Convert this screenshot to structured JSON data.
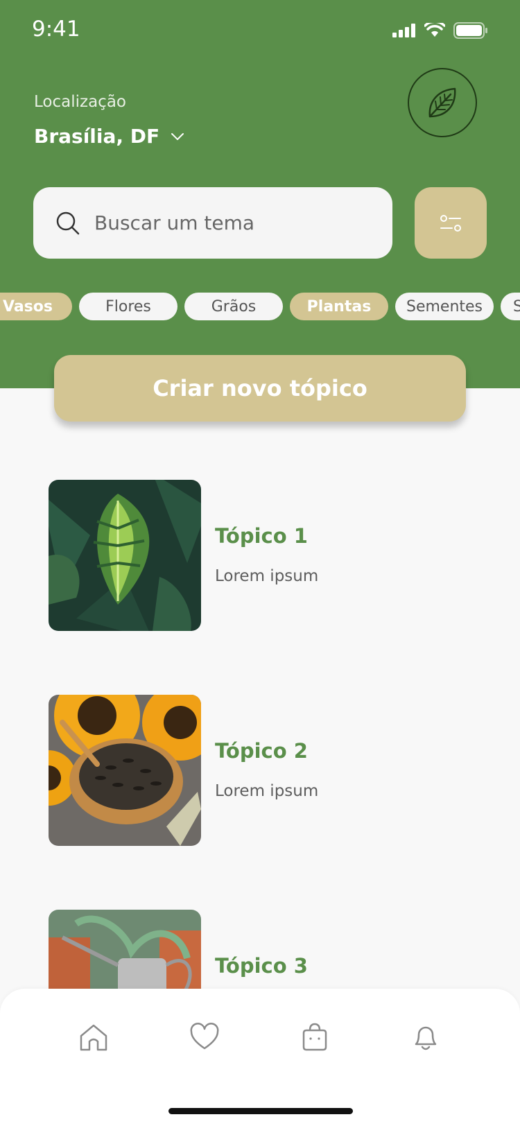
{
  "status": {
    "time": "9:41"
  },
  "location": {
    "label": "Localização",
    "value": "Brasília, DF"
  },
  "search": {
    "placeholder": "Buscar um tema"
  },
  "categories": [
    {
      "label": "Vasos",
      "active": true
    },
    {
      "label": "Flores",
      "active": false
    },
    {
      "label": "Grãos",
      "active": false
    },
    {
      "label": "Plantas",
      "active": true
    },
    {
      "label": "Sementes",
      "active": false
    },
    {
      "label": "S",
      "active": false
    }
  ],
  "actions": {
    "create_label": "Criar novo tópico"
  },
  "topics": [
    {
      "title": "Tópico 1",
      "subtitle": "Lorem ipsum"
    },
    {
      "title": "Tópico 2",
      "subtitle": "Lorem ipsum"
    },
    {
      "title": "Tópico 3",
      "subtitle": ""
    }
  ],
  "nav": [
    {
      "icon": "home-icon"
    },
    {
      "icon": "heart-icon"
    },
    {
      "icon": "bag-icon"
    },
    {
      "icon": "bell-icon"
    }
  ],
  "colors": {
    "brand_green": "#5a8f4a",
    "accent_tan": "#d3c593",
    "background": "#f8f8f8"
  }
}
